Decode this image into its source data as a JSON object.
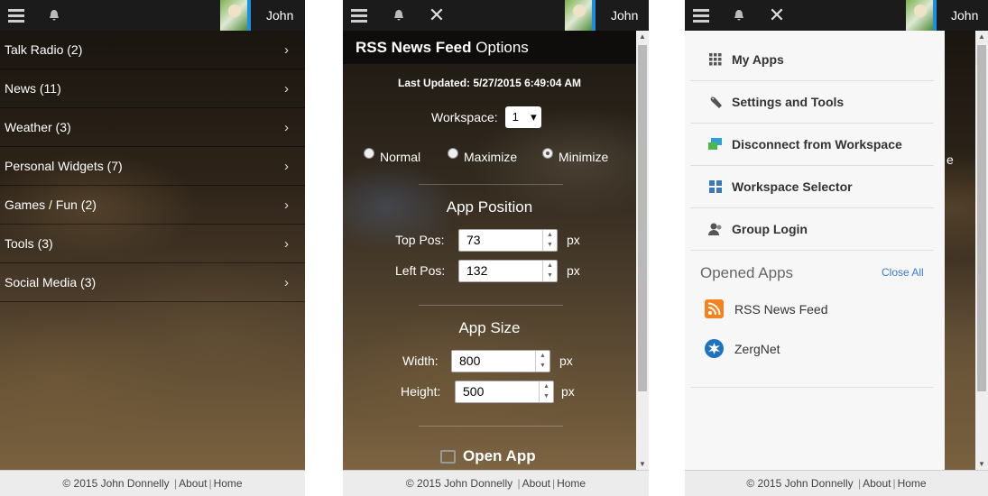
{
  "user": {
    "name": "John"
  },
  "footer": {
    "copyright": "© 2015 John Donnelly",
    "about": "About",
    "home": "Home",
    "sep": "|"
  },
  "panel1": {
    "categories": [
      {
        "label": "Talk Radio (2)"
      },
      {
        "label": "News (11)"
      },
      {
        "label": "Weather (3)"
      },
      {
        "label": "Personal Widgets (7)"
      },
      {
        "label": "Games / Fun (2)"
      },
      {
        "label": "Tools (3)"
      },
      {
        "label": "Social Media (3)"
      }
    ],
    "chevron": "›"
  },
  "panel2": {
    "title_bold": "RSS News Feed",
    "title_rest": " Options",
    "last_updated": "Last Updated: 5/27/2015 6:49:04 AM",
    "workspace_label": "Workspace:",
    "workspace_value": "1",
    "modes": {
      "normal": "Normal",
      "maximize": "Maximize",
      "minimize": "Minimize",
      "selected": "Minimize"
    },
    "position_title": "App Position",
    "top_label": "Top Pos:",
    "top_value": "73",
    "left_label": "Left Pos:",
    "left_value": "132",
    "size_title": "App Size",
    "width_label": "Width:",
    "width_value": "800",
    "height_label": "Height:",
    "height_value": "500",
    "unit": "px",
    "open_app": "Open App"
  },
  "panel3": {
    "menu": [
      {
        "label": "My Apps",
        "icon": "grid-icon"
      },
      {
        "label": "Settings and Tools",
        "icon": "wrench-icon"
      },
      {
        "label": "Disconnect from Workspace",
        "icon": "disconnect-icon"
      },
      {
        "label": "Workspace Selector",
        "icon": "workspace-icon"
      },
      {
        "label": "Group Login",
        "icon": "group-icon"
      }
    ],
    "opened_title": "Opened Apps",
    "close_all": "Close All",
    "apps": [
      {
        "label": "RSS News Feed",
        "icon": "rss-icon"
      },
      {
        "label": "ZergNet",
        "icon": "zergnet-icon"
      }
    ],
    "behind_text": "e"
  },
  "colors": {
    "accent": "#3a7bd5",
    "topbar": "#1b1b1b",
    "avatar_border": "#1b8fe0",
    "rss": "#f5821f",
    "zergnet": "#1e73be"
  }
}
